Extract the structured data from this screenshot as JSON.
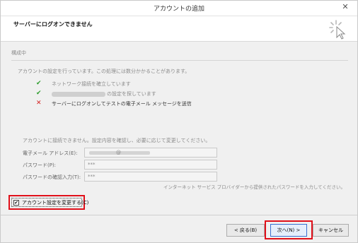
{
  "window": {
    "title": "アカウントの追加",
    "close_glyph": "✕"
  },
  "header": {
    "title": "サーバーにログオンできません",
    "icon": "wizard-cursor-icon"
  },
  "progress": {
    "section_label": "構成中",
    "intro": "アカウントの設定を行っています。この処理には数分かかることがあります。",
    "tasks": [
      {
        "status": "done",
        "glyph": "✔",
        "text": "ネットワーク接続を確立しています"
      },
      {
        "status": "done",
        "glyph": "✔",
        "text": "の設定を探しています"
      },
      {
        "status": "failed",
        "glyph": "✕",
        "text": "サーバーにログオンしてテストの電子メール メッセージを送信"
      }
    ]
  },
  "error": {
    "message": "アカウントに接続できません。設定内容を確認し、必要に応じて変更してください。"
  },
  "fields": {
    "email_label": "電子メール アドレス(E):",
    "email_domain_char": "@",
    "password_label": "パスワード(P):",
    "password_value": "***",
    "password_confirm_label": "パスワードの確認入力(T):",
    "password_confirm_value": "***",
    "hint": "インターネット サービス プロバイダーから提供されたパスワードを入力してください。"
  },
  "change_settings": {
    "label": "アカウント設定を変更する(C)",
    "checked": true,
    "check_glyph": "✔"
  },
  "buttons": {
    "back": "< 戻る(B)",
    "next": "次へ(N) >",
    "cancel": "キャンセル"
  },
  "colors": {
    "highlight": "#e0101a",
    "ok": "#2f9e2f",
    "fail": "#d42020"
  }
}
